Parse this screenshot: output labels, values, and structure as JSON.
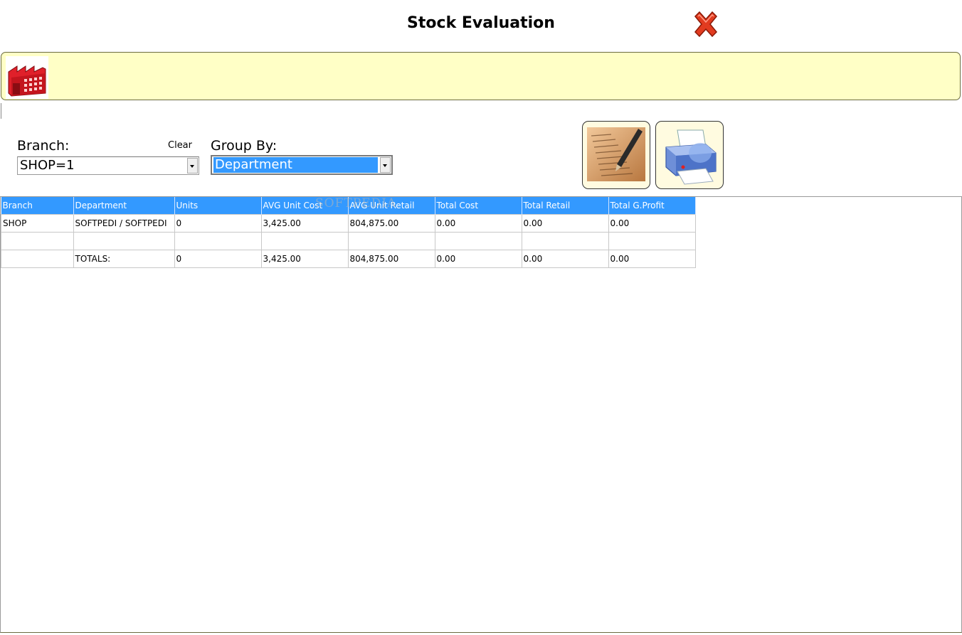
{
  "window": {
    "title": "Stock Evaluation"
  },
  "icons": {
    "close": "close-icon",
    "factory": "factory-icon",
    "report": "report-icon",
    "printer": "printer-icon"
  },
  "colors": {
    "accent": "#3399ff",
    "banner": "#ffffc6",
    "close": "#e23b1f"
  },
  "filters": {
    "branch_label": "Branch:",
    "clear_label": "Clear",
    "branch_value": "SHOP=1",
    "group_label": "Group By:",
    "group_value": "Department"
  },
  "grid": {
    "columns": [
      "Branch",
      "Department",
      "Units",
      "AVG Unit Cost",
      "AVG Unit Retail",
      "Total Cost",
      "Total Retail",
      "Total G.Profit"
    ],
    "rows": [
      [
        "SHOP",
        "SOFTPEDI / SOFTPEDI",
        "0",
        "3,425.00",
        "804,875.00",
        "0.00",
        "0.00",
        "0.00"
      ],
      [
        "",
        "",
        "",
        "",
        "",
        "",
        "",
        ""
      ],
      [
        "",
        "TOTALS:",
        "0",
        "3,425.00",
        "804,875.00",
        "0.00",
        "0.00",
        "0.00"
      ]
    ]
  },
  "watermark": "SOFTPEDIA"
}
